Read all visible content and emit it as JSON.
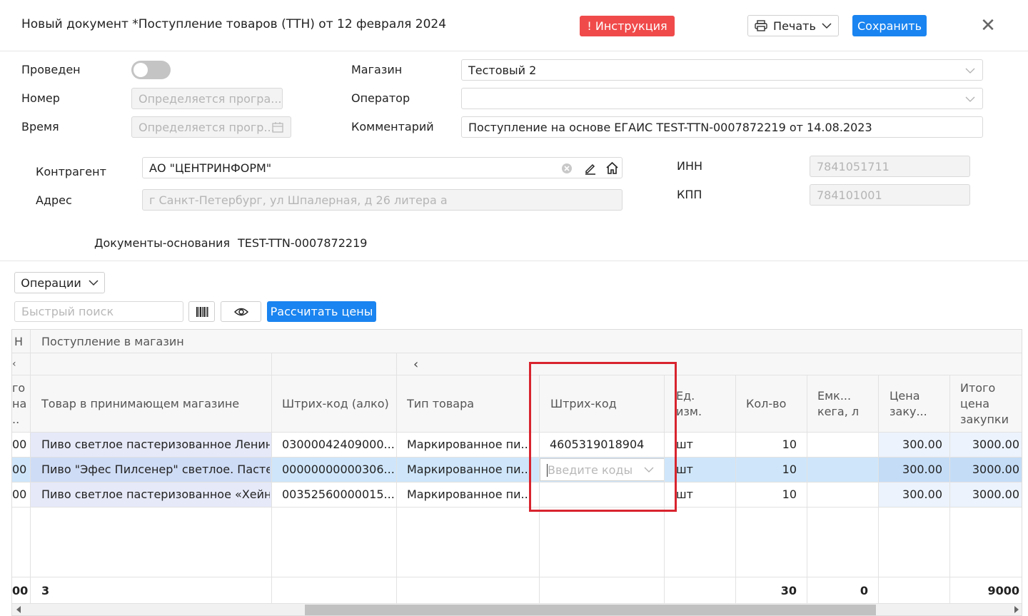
{
  "header": {
    "title": "Новый документ *Поступление товаров (ТТН) от 12 февраля 2024",
    "instruction_label": "! Инструкция",
    "print_label": "Печать",
    "save_label": "Сохранить"
  },
  "form": {
    "posted_label": "Проведен",
    "number_label": "Номер",
    "number_placeholder": "Определяется програ...",
    "time_label": "Время",
    "time_placeholder": "Определяется прогр...",
    "store_label": "Магазин",
    "store_value": "Тестовый 2",
    "operator_label": "Оператор",
    "operator_value": "",
    "comment_label": "Комментарий",
    "comment_value": "Поступление на основе ЕГАИС TEST-TTN-0007872219 от 14.08.2023",
    "counterparty_label": "Контрагент",
    "counterparty_value": "АО \"ЦЕНТРИНФОРМ\"",
    "address_label": "Адрес",
    "address_value": "г Санкт-Петербург, ул Шпалерная, д 26 литера а",
    "inn_label": "ИНН",
    "inn_value": "7841051711",
    "kpp_label": "КПП",
    "kpp_value": "784101001",
    "base_docs_label": "Документы-основания",
    "base_docs_value": "TEST-TTN-0007872219"
  },
  "toolbar": {
    "operations_label": "Операции",
    "search_placeholder": "Быстрый поиск",
    "calc_prices_label": "Рассчитать цены"
  },
  "table": {
    "group_header": "Поступление в магазин",
    "left_cut_header": "Н",
    "left_cut_col": [
      "го",
      "на",
      ".."
    ],
    "columns": {
      "product": "Товар в принимающем магазине",
      "barcode_alco": "Штрих-код (алко)",
      "product_type": "Тип товара",
      "barcode": "Штрих-код",
      "unit": "Ед. изм.",
      "qty": "Кол-во",
      "keg": "Емк... кега, л",
      "price": "Цена заку...",
      "total": "Итого цена закупки"
    },
    "rows": [
      {
        "left": "00",
        "product": "Пиво светлое пастеризованное Ленин...",
        "barcode_alco": "03000042409000...",
        "product_type": "Маркированное пи...",
        "barcode": "4605319018904",
        "unit": "шт",
        "qty": "10",
        "keg": "",
        "price": "300.00",
        "total": "3000.00"
      },
      {
        "left": "00",
        "product": "Пиво \"Эфес Пилсенер\" светлое. Пасте...",
        "barcode_alco": "00000000000306...",
        "product_type": "Маркированное пи...",
        "barcode": "",
        "barcode_placeholder": "Введите коды",
        "unit": "шт",
        "qty": "10",
        "keg": "",
        "price": "300.00",
        "total": "3000.00"
      },
      {
        "left": "00",
        "product": "Пиво светлое пастеризованное «Хейн...",
        "barcode_alco": "00352560000015...",
        "product_type": "Маркированное пи...",
        "barcode": "",
        "unit": "шт",
        "qty": "10",
        "keg": "",
        "price": "300.00",
        "total": "3000.00"
      }
    ],
    "footer": {
      "left": "00",
      "count": "3",
      "qty": "30",
      "keg": "0",
      "total": "9000"
    }
  }
}
